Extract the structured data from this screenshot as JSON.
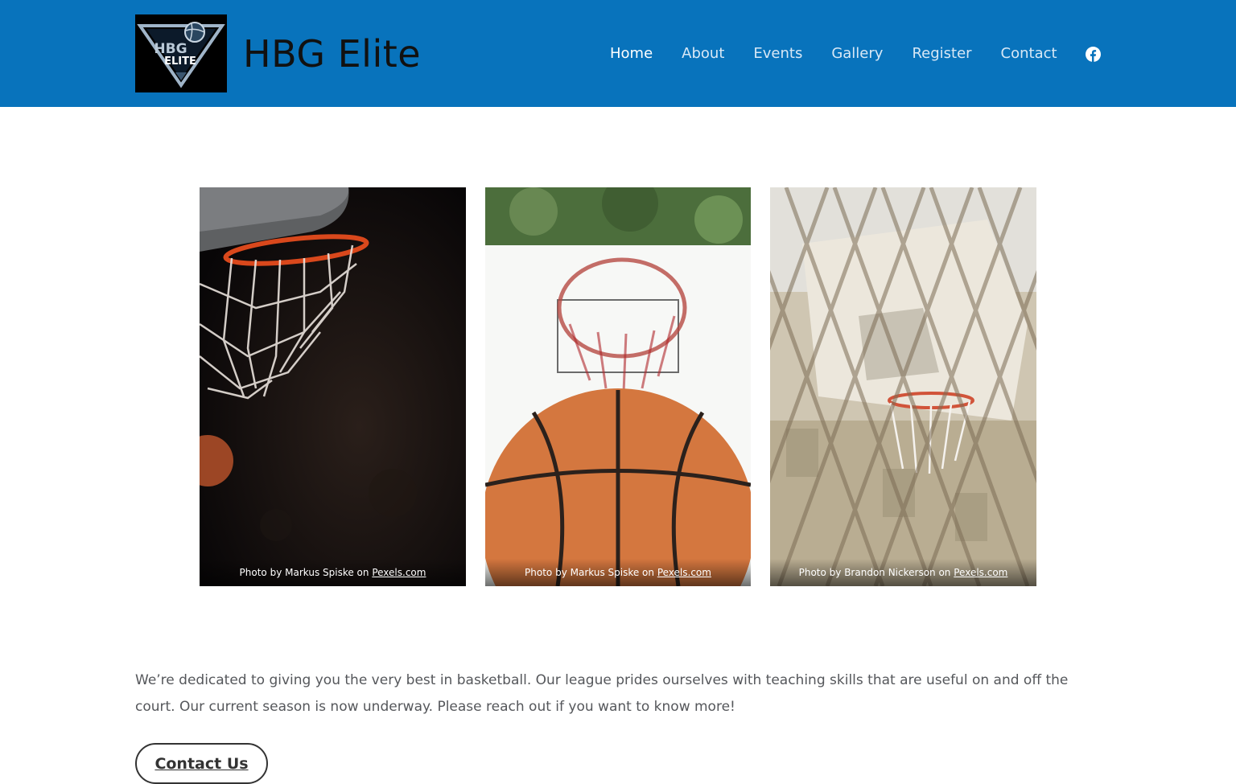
{
  "header": {
    "site_title": "HBG Elite",
    "logo_text_top": "HBG",
    "logo_text_bottom": "ELITE",
    "brand_color": "#0873bc",
    "nav": [
      {
        "label": "Home",
        "active": true
      },
      {
        "label": "About",
        "active": false
      },
      {
        "label": "Events",
        "active": false
      },
      {
        "label": "Gallery",
        "active": false
      },
      {
        "label": "Register",
        "active": false
      },
      {
        "label": "Contact",
        "active": false
      }
    ],
    "social_icon": "facebook-icon"
  },
  "gallery": [
    {
      "credit_prefix": "Photo by Markus Spiske on ",
      "credit_link": "Pexels.com"
    },
    {
      "credit_prefix": "Photo by Markus Spiske on ",
      "credit_link": "Pexels.com"
    },
    {
      "credit_prefix": "Photo by Brandon Nickerson on ",
      "credit_link": "Pexels.com"
    }
  ],
  "intro": {
    "text": "We’re dedicated to giving you the very best in basketball. Our league prides ourselves with teaching skills that are useful on and off the court. Our current season is now underway. Please reach out if you want to know more!"
  },
  "cta": {
    "label": "Contact Us"
  }
}
